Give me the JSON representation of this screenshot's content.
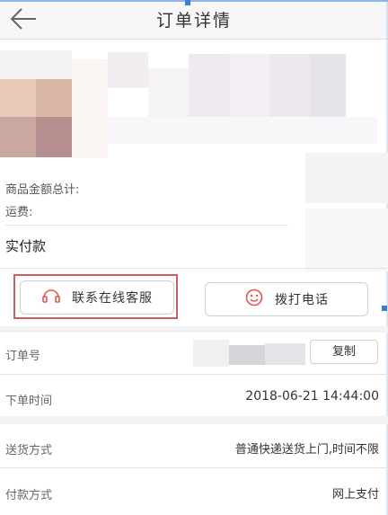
{
  "header": {
    "title": "订单详情"
  },
  "summary": {
    "goods_total_label": "商品金额总计:",
    "shipping_label": "运费:",
    "paid_label": "实付款"
  },
  "actions": {
    "chat_label": "联系在线客服",
    "call_label": "拨打电话"
  },
  "order": {
    "order_no_label": "订单号",
    "copy_label": "复制",
    "time_label": "下单时间",
    "time_value": "2018-06-21 14:44:00"
  },
  "delivery": {
    "method_label": "送货方式",
    "method_value": "普通快递送货上门,时间不限",
    "payment_label": "付款方式",
    "payment_value": "网上支付"
  },
  "colors": {
    "highlight": "#c9605e",
    "accent": "#e0554f"
  },
  "icons": {
    "back": "back-arrow-icon",
    "chat": "headset-icon",
    "call": "smile-phone-icon"
  }
}
